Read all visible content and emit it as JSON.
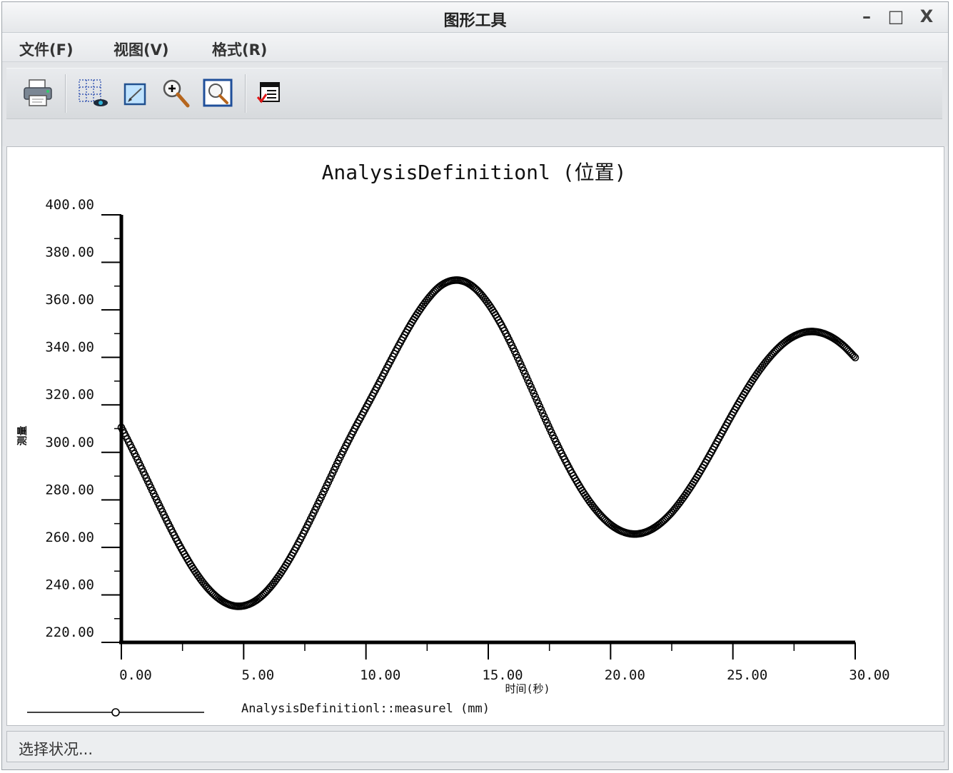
{
  "window": {
    "title": "图形工具",
    "controls": {
      "minimize": "–",
      "maximize": "□",
      "close": "X"
    }
  },
  "menu": {
    "items": [
      "文件(F)",
      "视图(V)",
      "格式(R)"
    ]
  },
  "toolbar": {
    "icons": [
      "printer-icon",
      "grid-view-icon",
      "edit-icon",
      "zoom-in-icon",
      "zoom-fit-icon",
      "format-icon"
    ]
  },
  "status": {
    "text": "选择状况..."
  },
  "chart_data": {
    "type": "scatter",
    "title": "AnalysisDefinitionl (位置)",
    "xlabel": "时间(秒)",
    "ylabel": "测量",
    "xlim": [
      0,
      30
    ],
    "ylim": [
      220,
      400
    ],
    "x_ticks": [
      "0.00",
      "5.00",
      "10.00",
      "15.00",
      "20.00",
      "25.00",
      "30.00"
    ],
    "y_ticks": [
      "220.00",
      "240.00",
      "260.00",
      "280.00",
      "300.00",
      "320.00",
      "340.00",
      "360.00",
      "380.00",
      "400.00"
    ],
    "legend": "AnalysisDefinitionl::measurel (mm)",
    "legend_position": "bottom-left",
    "series": [
      {
        "name": "AnalysisDefinitionl::measurel (mm)",
        "x": [
          0,
          0.5,
          1,
          1.5,
          2,
          2.5,
          3,
          3.5,
          4,
          4.5,
          5,
          5.5,
          6,
          6.5,
          7,
          7.5,
          8,
          8.5,
          9,
          9.5,
          10,
          10.5,
          11,
          11.5,
          12,
          12.5,
          13,
          13.5,
          14,
          14.5,
          15,
          15.5,
          16,
          16.5,
          17,
          17.5,
          18,
          18.5,
          19,
          19.5,
          20,
          20.5,
          21,
          21.5,
          22,
          22.5,
          23,
          23.5,
          24,
          24.5,
          25,
          25.5,
          26,
          26.5,
          27,
          27.5,
          28,
          28.5,
          29,
          29.5,
          30
        ],
        "y": [
          310.5,
          300.3,
          289.6,
          278.8,
          268.3,
          258.6,
          250.1,
          243.2,
          238.3,
          235.6,
          235.4,
          237.6,
          242.2,
          248.9,
          257.3,
          267.0,
          277.5,
          288.3,
          299.1,
          309.2,
          318.8,
          328.5,
          338.4,
          348.0,
          356.8,
          364.2,
          369.7,
          372.3,
          372.0,
          368.7,
          362.6,
          354.3,
          344.2,
          333.1,
          321.6,
          310.2,
          299.5,
          289.8,
          281.4,
          274.6,
          269.6,
          266.6,
          265.6,
          266.7,
          269.8,
          274.7,
          281.3,
          289.1,
          297.9,
          307.2,
          316.5,
          325.3,
          333.3,
          340.0,
          345.3,
          348.9,
          350.7,
          350.6,
          348.7,
          345.1,
          339.9
        ]
      }
    ]
  }
}
